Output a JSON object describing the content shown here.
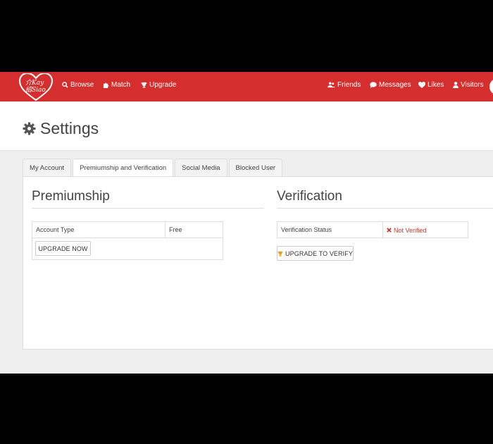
{
  "brand": {
    "logo_text_top": "介Kay",
    "logo_text_bottom": "绍Siao",
    "color": "#d42e2e"
  },
  "nav": {
    "left": [
      {
        "label": "Browse",
        "icon": "search-icon"
      },
      {
        "label": "Match",
        "icon": "puzzle-icon"
      },
      {
        "label": "Upgrade",
        "icon": "trophy-icon"
      }
    ],
    "right": [
      {
        "label": "Friends",
        "icon": "users-icon"
      },
      {
        "label": "Messages",
        "icon": "comment-icon"
      },
      {
        "label": "Likes",
        "icon": "heart-icon"
      },
      {
        "label": "Visitors",
        "icon": "user-icon"
      }
    ]
  },
  "page": {
    "title": "Settings",
    "icon": "gear-icon"
  },
  "tabs": [
    {
      "label": "My Account",
      "active": false
    },
    {
      "label": "Premiumship and Verification",
      "active": true
    },
    {
      "label": "Social Media",
      "active": false
    },
    {
      "label": "Blocked User",
      "active": false
    }
  ],
  "premiumship": {
    "title": "Premiumship",
    "row_label": "Account Type",
    "row_value": "Free",
    "button": "UPGRADE NOW"
  },
  "verification": {
    "title": "Verification",
    "row_label": "Verification Status",
    "row_value": "Not Verified",
    "status_color": "#c0392b",
    "button": "UPGRADE TO VERIFY",
    "button_icon": "trophy-icon",
    "button_icon_color": "#e0a21a"
  }
}
